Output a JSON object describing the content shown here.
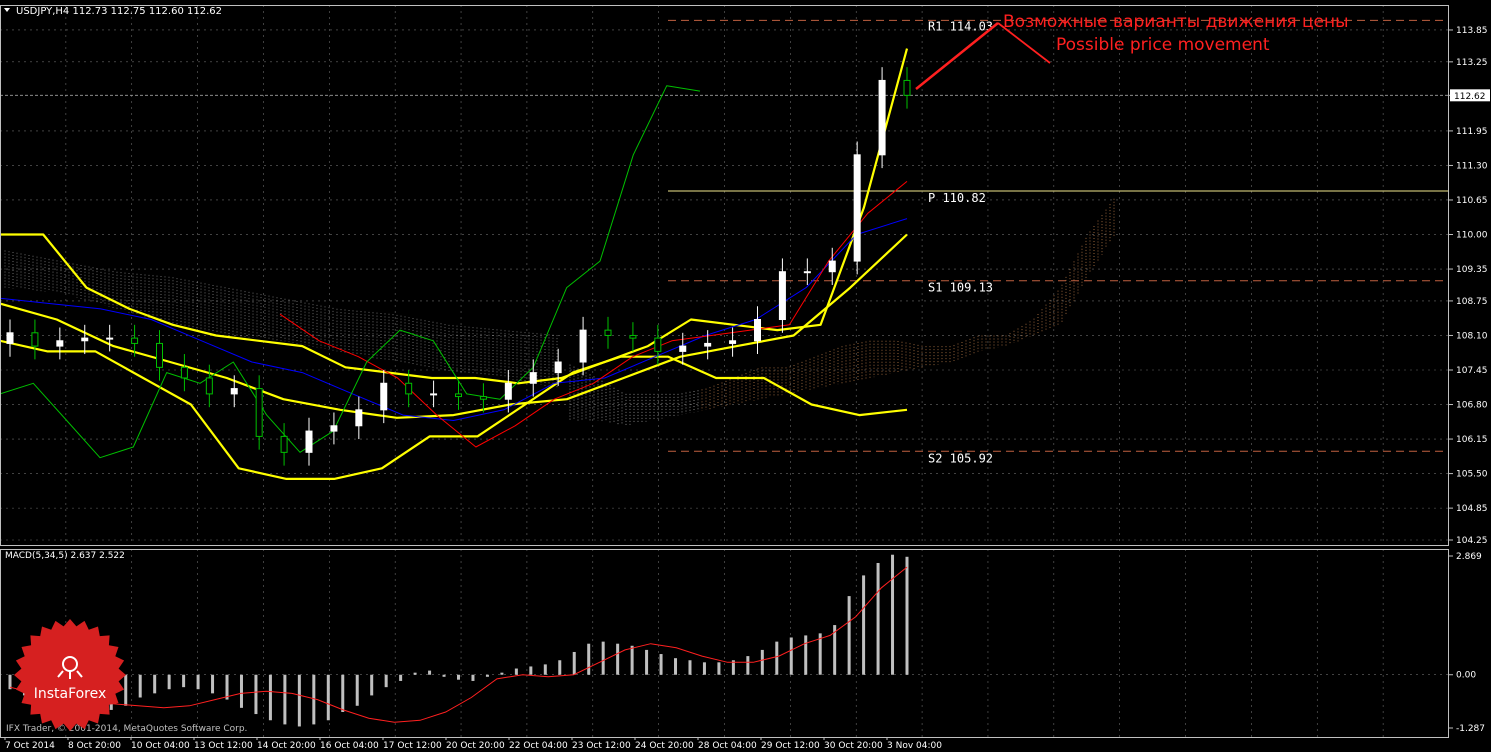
{
  "window": {
    "symbol_header": "USDJPY,H4  112.73 112.75 112.60 112.62",
    "footer_copyright": "IFX Trader, © 2001-2014, MetaQuotes Software Corp.",
    "logo_text": "InstaForex"
  },
  "colors": {
    "background": "#000000",
    "grid": "#c0c0c0",
    "candle_up": "#ffffff",
    "candle_down": "#00c000",
    "bollinger": "#ffff00",
    "kijun": "#0000ff",
    "tenkan": "#ff0000",
    "chikou": "#00c000",
    "cloud_a": "#f4a460",
    "cloud_b": "#d8d8d8",
    "pivot": "#f0e68c",
    "levels": "#c06040",
    "annotation": "#ff2020",
    "macd_hist": "#c0c0c0",
    "macd_signal": "#ff2020",
    "logo": "#d62020"
  },
  "annotation": {
    "line1": "Возможные варианты движения цены",
    "line2": "Possible price movement"
  },
  "chart_data": [
    {
      "type": "line",
      "panel": "main",
      "title": "USDJPY,H4",
      "ylim": [
        104.25,
        114.0
      ],
      "y_ticks": [
        "113.85",
        "113.25",
        "112.62",
        "111.95",
        "111.30",
        "110.65",
        "110.00",
        "109.35",
        "108.75",
        "108.10",
        "107.45",
        "106.80",
        "106.15",
        "105.50",
        "104.85",
        "104.25"
      ],
      "current_price": 112.62,
      "current_price_label": "112.62",
      "x_tick_labels": [
        "7 Oct 2014",
        "8 Oct 20:00",
        "10 Oct 04:00",
        "13 Oct 12:00",
        "14 Oct 20:00",
        "16 Oct 04:00",
        "17 Oct 12:00",
        "20 Oct 20:00",
        "22 Oct 04:00",
        "23 Oct 12:00",
        "24 Oct 20:00",
        "28 Oct 04:00",
        "29 Oct 12:00",
        "30 Oct 20:00",
        "3 Nov 04:00"
      ],
      "pivot_levels": [
        {
          "label": "R1",
          "value": 114.03,
          "text": "R1  114.03"
        },
        {
          "label": "P",
          "value": 110.82,
          "text": "P  110.82"
        },
        {
          "label": "S1",
          "value": 109.13,
          "text": "S1  109.13"
        },
        {
          "label": "S2",
          "value": 105.92,
          "text": "S2  105.92"
        }
      ],
      "series": [
        {
          "name": "close",
          "values": [
            108.15,
            107.9,
            108.0,
            108.05,
            108.05,
            107.95,
            107.5,
            107.3,
            107.0,
            107.1,
            106.2,
            105.9,
            106.3,
            106.4,
            106.7,
            107.2,
            107.0,
            107.0,
            106.95,
            106.9,
            107.2,
            107.4,
            107.6,
            108.2,
            108.1,
            108.05,
            107.8,
            107.9,
            107.95,
            108.0,
            108.4,
            109.3,
            109.3,
            109.5,
            111.5,
            112.9,
            112.62
          ]
        },
        {
          "name": "bollinger_upper",
          "values": [
            110.0,
            110.0,
            109.0,
            108.6,
            108.3,
            108.1,
            108.0,
            107.9,
            107.5,
            107.4,
            107.3,
            107.3,
            107.2,
            107.3,
            107.6,
            107.9,
            108.4,
            108.3,
            108.2,
            108.3,
            110.5,
            113.5
          ]
        },
        {
          "name": "bollinger_middle",
          "values": [
            108.7,
            108.4,
            107.9,
            107.6,
            107.3,
            106.9,
            106.7,
            106.55,
            106.6,
            106.8,
            106.9,
            107.3,
            107.7,
            107.9,
            108.1,
            109.0,
            110.0
          ]
        },
        {
          "name": "bollinger_lower",
          "values": [
            108.0,
            107.8,
            107.8,
            107.3,
            106.8,
            105.6,
            105.4,
            105.4,
            105.6,
            106.2,
            106.2,
            106.8,
            107.4,
            107.7,
            107.7,
            107.3,
            107.3,
            106.8,
            106.6,
            106.7
          ]
        },
        {
          "name": "kijun",
          "values": [
            108.8,
            108.7,
            108.6,
            108.4,
            108.0,
            107.6,
            107.4,
            107.0,
            106.6,
            106.5,
            106.7,
            107.2,
            107.3,
            107.7,
            108.1,
            108.4,
            109.0,
            110.0,
            110.3
          ]
        },
        {
          "name": "tenkan",
          "values": [
            108.5,
            108.0,
            107.7,
            107.3,
            106.6,
            106.0,
            106.4,
            106.9,
            107.2,
            107.7,
            108.0,
            108.1,
            108.2,
            108.3,
            109.5,
            110.4,
            111.0
          ]
        },
        {
          "name": "chikou",
          "values": [
            107.0,
            107.2,
            106.5,
            105.8,
            106.0,
            107.4,
            107.2,
            107.6,
            106.6,
            105.9,
            106.3,
            107.6,
            108.2,
            108.0,
            107.0,
            106.9,
            107.5,
            109.0,
            109.5,
            111.5,
            112.8,
            112.7
          ]
        }
      ]
    },
    {
      "type": "bar",
      "panel": "macd",
      "title": "MACD(5,34,5) 2.637 2.522",
      "ylim": [
        -1.287,
        2.869
      ],
      "y_ticks": [
        "2.869",
        "0.00",
        "-1.287"
      ],
      "series": [
        {
          "name": "histogram",
          "values": [
            -0.35,
            -0.5,
            -0.55,
            -0.6,
            -0.7,
            -0.75,
            -0.8,
            -0.85,
            -0.75,
            -0.55,
            -0.45,
            -0.35,
            -0.3,
            -0.35,
            -0.45,
            -0.6,
            -0.8,
            -0.95,
            -1.1,
            -1.2,
            -1.25,
            -1.2,
            -1.1,
            -0.9,
            -0.75,
            -0.5,
            -0.3,
            -0.15,
            0.05,
            0.1,
            -0.05,
            -0.12,
            -0.15,
            -0.05,
            0.05,
            0.15,
            0.2,
            0.25,
            0.35,
            0.55,
            0.75,
            0.8,
            0.75,
            0.7,
            0.6,
            0.5,
            0.4,
            0.35,
            0.3,
            0.3,
            0.35,
            0.45,
            0.6,
            0.8,
            0.9,
            0.95,
            1.0,
            1.2,
            1.9,
            2.4,
            2.7,
            2.9,
            2.85
          ]
        },
        {
          "name": "signal",
          "values": [
            -0.3,
            -0.45,
            -0.55,
            -0.65,
            -0.7,
            -0.75,
            -0.8,
            -0.75,
            -0.6,
            -0.45,
            -0.4,
            -0.45,
            -0.6,
            -0.85,
            -1.05,
            -1.15,
            -1.1,
            -0.9,
            -0.55,
            -0.1,
            0.0,
            -0.05,
            0.0,
            0.3,
            0.6,
            0.75,
            0.65,
            0.45,
            0.3,
            0.3,
            0.45,
            0.75,
            0.95,
            1.4,
            2.1,
            2.6
          ]
        }
      ]
    }
  ]
}
